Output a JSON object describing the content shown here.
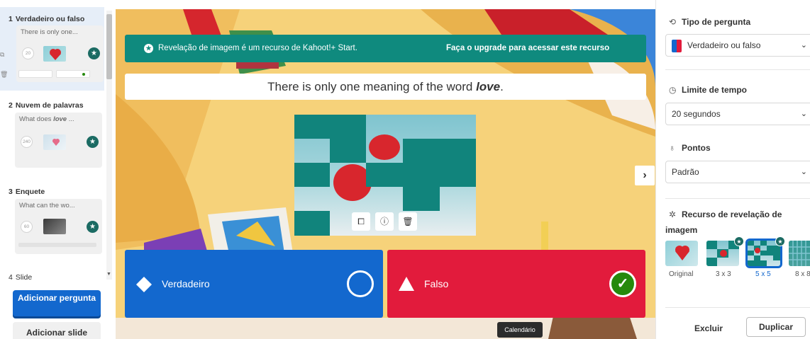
{
  "sidebar": {
    "slides": [
      {
        "number": "1",
        "type": "Verdadeiro ou falso",
        "preview": "There is only one...",
        "timer": "20"
      },
      {
        "number": "2",
        "type": "Nuvem de palavras",
        "preview_prefix": "What does ",
        "preview_em": "love",
        "preview_suffix": " ...",
        "timer": "240"
      },
      {
        "number": "3",
        "type": "Enquete",
        "preview": "What can the wo...",
        "timer": "60"
      },
      {
        "number": "4",
        "type": "Slide"
      }
    ],
    "add_question": "Adicionar pergunta",
    "add_slide": "Adicionar slide"
  },
  "canvas": {
    "banner_message": "Revelação de imagem é um recurso de Kahoot!+ Start.",
    "banner_upgrade": "Faça o upgrade para acessar este recurso",
    "question_prefix": "There is only one meaning of the word ",
    "question_em": "love",
    "question_suffix": ".",
    "answers": [
      {
        "label": "Verdadeiro",
        "shape": "diamond",
        "correct": false,
        "color": "#1368ce"
      },
      {
        "label": "Falso",
        "shape": "triangle",
        "correct": true,
        "color": "#e21b3c"
      }
    ],
    "tooltip": "Calendário",
    "image_tools": [
      "crop-icon",
      "info-icon",
      "trash-icon"
    ]
  },
  "panel": {
    "question_type_title": "Tipo de pergunta",
    "question_type_value": "Verdadeiro ou falso",
    "time_limit_title": "Limite de tempo",
    "time_limit_value": "20 segundos",
    "points_title": "Pontos",
    "points_value": "Padrão",
    "reveal_title_line1": "Recurso de revelação de",
    "reveal_title_line2": "imagem",
    "reveal_options": [
      {
        "label": "Original",
        "selected": false,
        "premium": false
      },
      {
        "label": "3 x 3",
        "selected": false,
        "premium": true
      },
      {
        "label": "5 x 5",
        "selected": true,
        "premium": true
      },
      {
        "label": "8 x 8",
        "selected": false,
        "premium": false
      }
    ],
    "delete": "Excluir",
    "duplicate": "Duplicar"
  },
  "colors": {
    "accent": "#1368ce",
    "teal": "#0f8a7e",
    "true_answer": "#1368ce",
    "false_answer": "#e21b3c",
    "correct": "#26890c"
  }
}
